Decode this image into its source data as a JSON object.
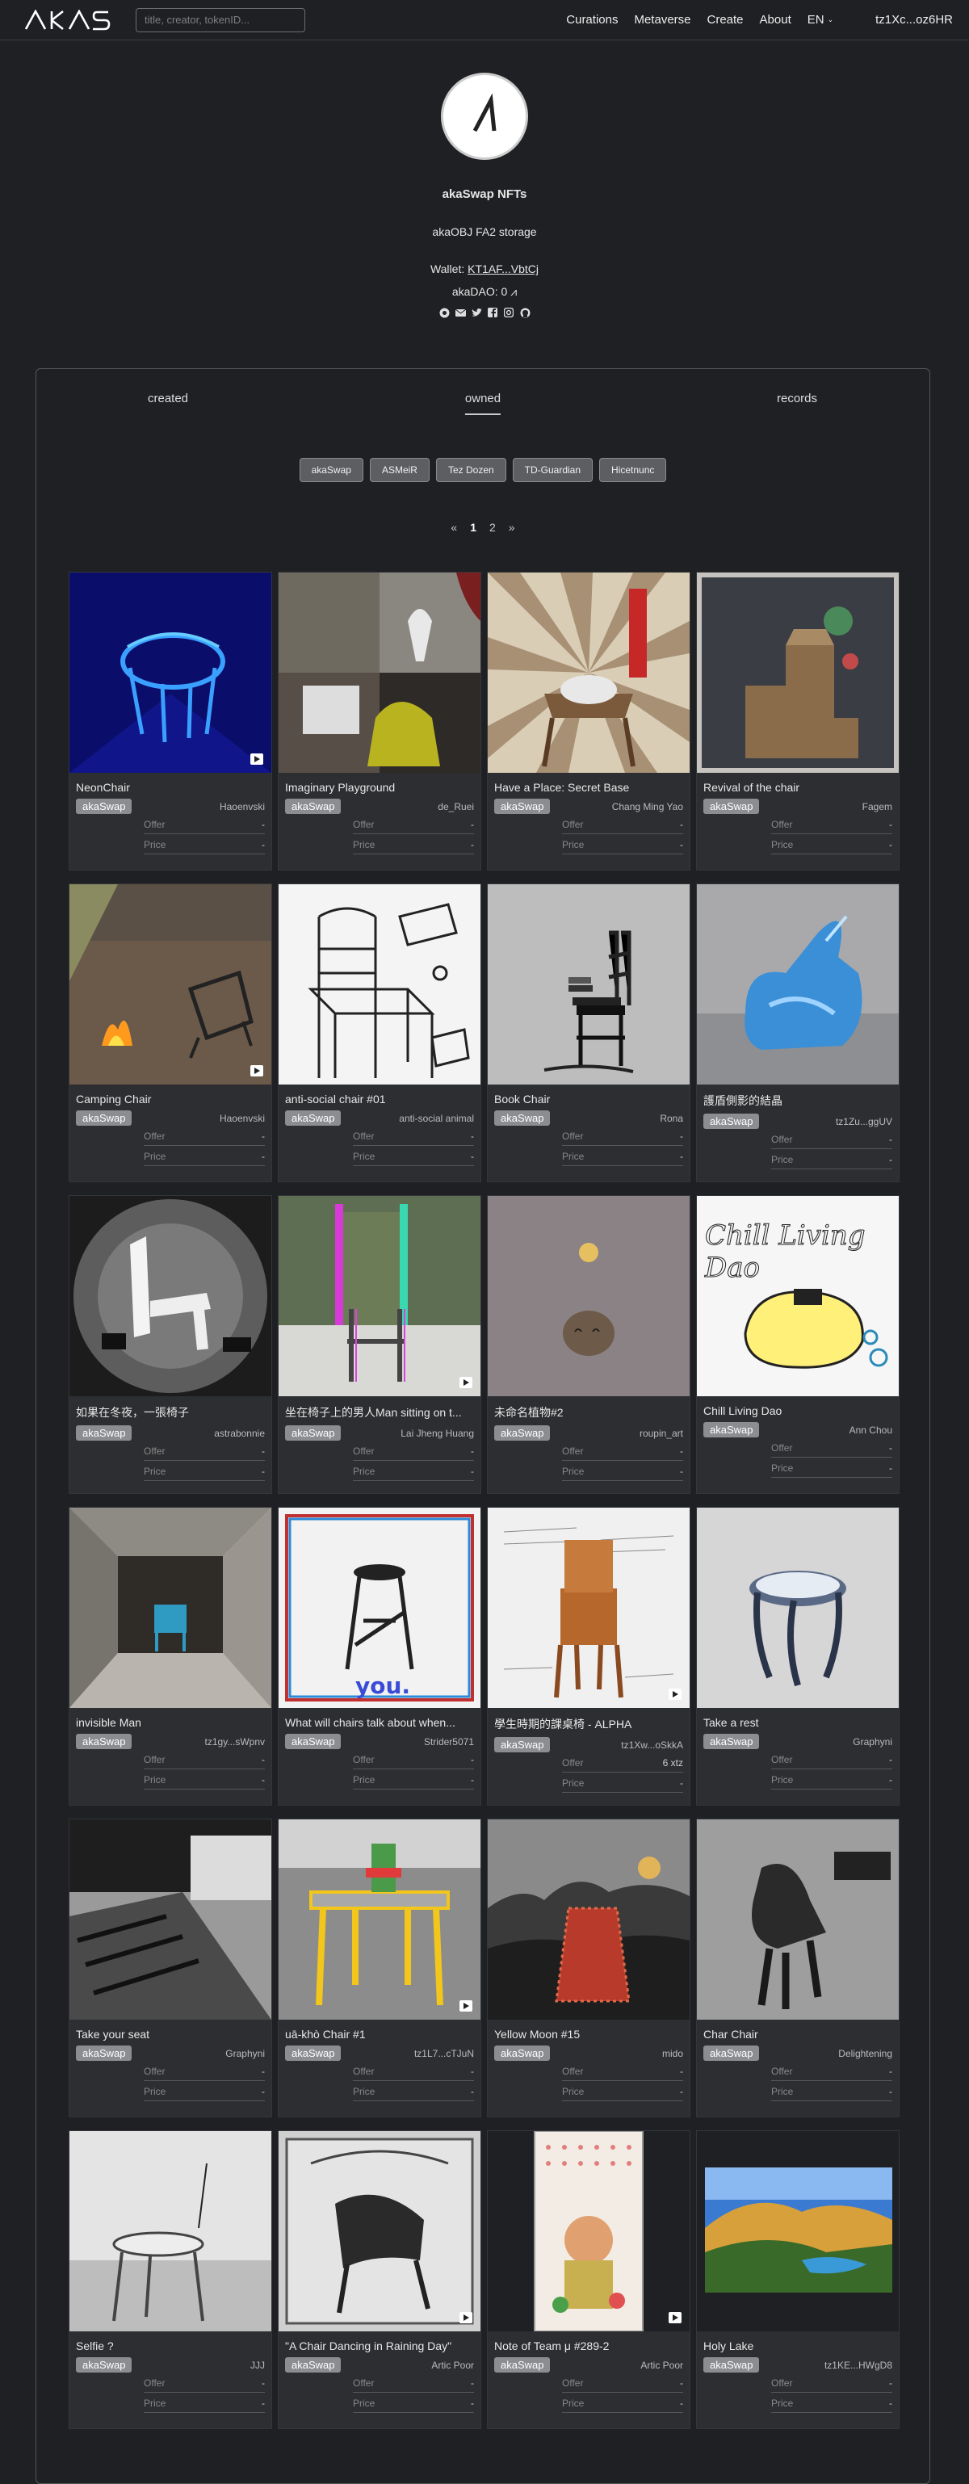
{
  "header": {
    "search_placeholder": "title, creator, tokenID...",
    "nav": [
      "Curations",
      "Metaverse",
      "Create",
      "About"
    ],
    "lang": "EN",
    "theme_icon": "moon-icon",
    "wallet": "tz1Xc...oz6HR"
  },
  "profile": {
    "name": "akaSwap NFTs",
    "storage": "akaOBJ FA2 storage",
    "wallet_label": "Wallet: ",
    "wallet": "KT1AF...VbtCj",
    "dao": "akaDAO: 0 ⩘"
  },
  "tabs": [
    "created",
    "owned",
    "records"
  ],
  "filters": [
    "akaSwap",
    "ASMeiR",
    "Tez Dozen",
    "TD-Guardian",
    "Hicetnunc"
  ],
  "pager": {
    "prev": "«",
    "pages": [
      "1",
      "2"
    ],
    "next": "»"
  },
  "labels": {
    "offer": "Offer",
    "price": "Price"
  },
  "cards": [
    {
      "title": "NeonChair",
      "platform": "akaSwap",
      "creator": "Haoenvski",
      "offer": "-",
      "price": "-",
      "art": "neon",
      "video": true
    },
    {
      "title": "Imaginary Playground",
      "platform": "akaSwap",
      "creator": "de_Ruei",
      "offer": "-",
      "price": "-",
      "art": "play",
      "video": false
    },
    {
      "title": "Have a Place: Secret Base",
      "platform": "akaSwap",
      "creator": "Chang Ming Yao",
      "offer": "-",
      "price": "-",
      "art": "rays",
      "video": false
    },
    {
      "title": "Revival of the chair",
      "platform": "akaSwap",
      "creator": "Fagem",
      "offer": "-",
      "price": "-",
      "art": "revival",
      "video": false
    },
    {
      "title": "Camping Chair",
      "platform": "akaSwap",
      "creator": "Haoenvski",
      "offer": "-",
      "price": "-",
      "art": "camp",
      "video": true
    },
    {
      "title": "anti-social chair #01",
      "platform": "akaSwap",
      "creator": "anti-social animal",
      "offer": "-",
      "price": "-",
      "art": "sketch",
      "video": false
    },
    {
      "title": "Book Chair",
      "platform": "akaSwap",
      "creator": "Rona",
      "offer": "-",
      "price": "-",
      "art": "book",
      "video": false
    },
    {
      "title": "護盾側影的結晶",
      "platform": "akaSwap",
      "creator": "tz1Zu...ggUV",
      "offer": "-",
      "price": "-",
      "art": "crystal",
      "video": false
    },
    {
      "title": "如果在冬夜，一張椅子",
      "platform": "akaSwap",
      "creator": "astrabonnie",
      "offer": "-",
      "price": "-",
      "art": "winter",
      "video": false
    },
    {
      "title": "坐在椅子上的男人Man sitting on t...",
      "platform": "akaSwap",
      "creator": "Lai Jheng Huang",
      "offer": "-",
      "price": "-",
      "art": "glitch",
      "video": true
    },
    {
      "title": "未命名植物#2",
      "platform": "akaSwap",
      "creator": "roupin_art",
      "offer": "-",
      "price": "-",
      "art": "plant",
      "video": false
    },
    {
      "title": "Chill Living Dao",
      "platform": "akaSwap",
      "creator": "Ann Chou",
      "offer": "-",
      "price": "-",
      "art": "chill",
      "video": false
    },
    {
      "title": "invisible Man",
      "platform": "akaSwap",
      "creator": "tz1gy...sWpnv",
      "offer": "-",
      "price": "-",
      "art": "room",
      "video": false
    },
    {
      "title": "What will chairs talk about when...",
      "platform": "akaSwap",
      "creator": "Strider5071",
      "offer": "-",
      "price": "-",
      "art": "stool",
      "video": false
    },
    {
      "title": "學生時期的課桌椅 - ALPHA",
      "platform": "akaSwap",
      "creator": "tz1Xw...oSkkA",
      "offer": "6 xtz",
      "price": "-",
      "art": "desk",
      "video": true
    },
    {
      "title": "Take a rest",
      "platform": "akaSwap",
      "creator": "Graphyni",
      "offer": "-",
      "price": "-",
      "art": "rest",
      "video": false
    },
    {
      "title": "Take your seat",
      "platform": "akaSwap",
      "creator": "Graphyni",
      "offer": "-",
      "price": "-",
      "art": "seat",
      "video": false
    },
    {
      "title": "uā-khò Chair #1",
      "platform": "akaSwap",
      "creator": "tz1L7...cTJuN",
      "offer": "-",
      "price": "-",
      "art": "table",
      "video": true
    },
    {
      "title": "Yellow Moon #15",
      "platform": "akaSwap",
      "creator": "mido",
      "offer": "-",
      "price": "-",
      "art": "moon",
      "video": false
    },
    {
      "title": "Char Chair",
      "platform": "akaSwap",
      "creator": "Delightening",
      "offer": "-",
      "price": "-",
      "art": "char",
      "video": false
    },
    {
      "title": "Selfie ?",
      "platform": "akaSwap",
      "creator": "JJJ",
      "offer": "-",
      "price": "-",
      "art": "selfie",
      "video": false
    },
    {
      "title": "\"A Chair Dancing in Raining Day\"",
      "platform": "akaSwap",
      "creator": "Artic Poor",
      "offer": "-",
      "price": "-",
      "art": "dance",
      "video": true
    },
    {
      "title": "Note of Team μ #289-2",
      "platform": "akaSwap",
      "creator": "Artic Poor",
      "offer": "-",
      "price": "-",
      "art": "note",
      "video": true
    },
    {
      "title": "Holy Lake",
      "platform": "akaSwap",
      "creator": "tz1KE...HWgD8",
      "offer": "-",
      "price": "-",
      "art": "lake",
      "video": false
    }
  ]
}
